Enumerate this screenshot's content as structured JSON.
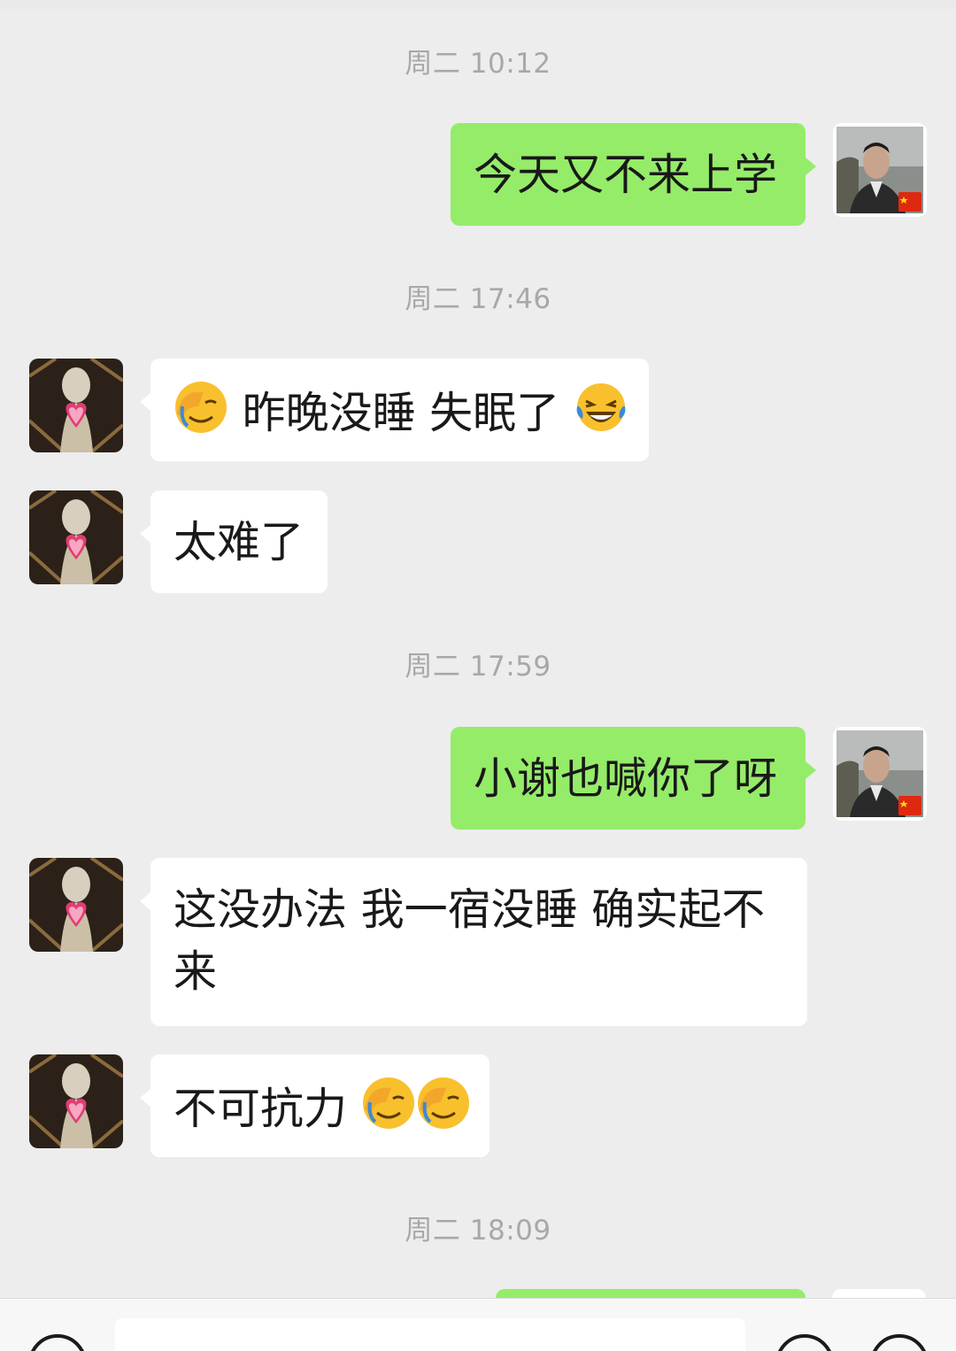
{
  "chat": {
    "messages": [
      {
        "type": "time",
        "text": "周二 10:12"
      },
      {
        "type": "sent",
        "text": "今天又不来上学"
      },
      {
        "type": "time",
        "text": "周二 17:46"
      },
      {
        "type": "received",
        "parts": [
          "昨晚没睡 失眠了"
        ],
        "emoji_before": "facepalm-emoji",
        "emoji_after": "laughing-tears-emoji"
      },
      {
        "type": "received",
        "text": "太难了"
      },
      {
        "type": "time",
        "text": "周二 17:59"
      },
      {
        "type": "sent",
        "text": "小谢也喊你了呀"
      },
      {
        "type": "received",
        "text_line1": "这没办法 我一宿没睡 确实起不",
        "text_line2": "来"
      },
      {
        "type": "received",
        "text": "不可抗力",
        "emoji_after": [
          "facepalm-emoji",
          "facepalm-emoji"
        ]
      },
      {
        "type": "time",
        "text": "周二 18:09"
      }
    ]
  },
  "colors": {
    "background": "#ededed",
    "sent_bubble": "#95ec69",
    "received_bubble": "#ffffff",
    "timestamp": "#a8a8a8",
    "text": "#191919"
  },
  "icons": {
    "self_avatar": "man-portrait-avatar",
    "self_badge": "china-flag-badge",
    "contact_avatar": "heart-statue-avatar",
    "input_left": "voice-icon",
    "input_right_1": "emoji-icon",
    "input_right_2": "plus-icon"
  }
}
